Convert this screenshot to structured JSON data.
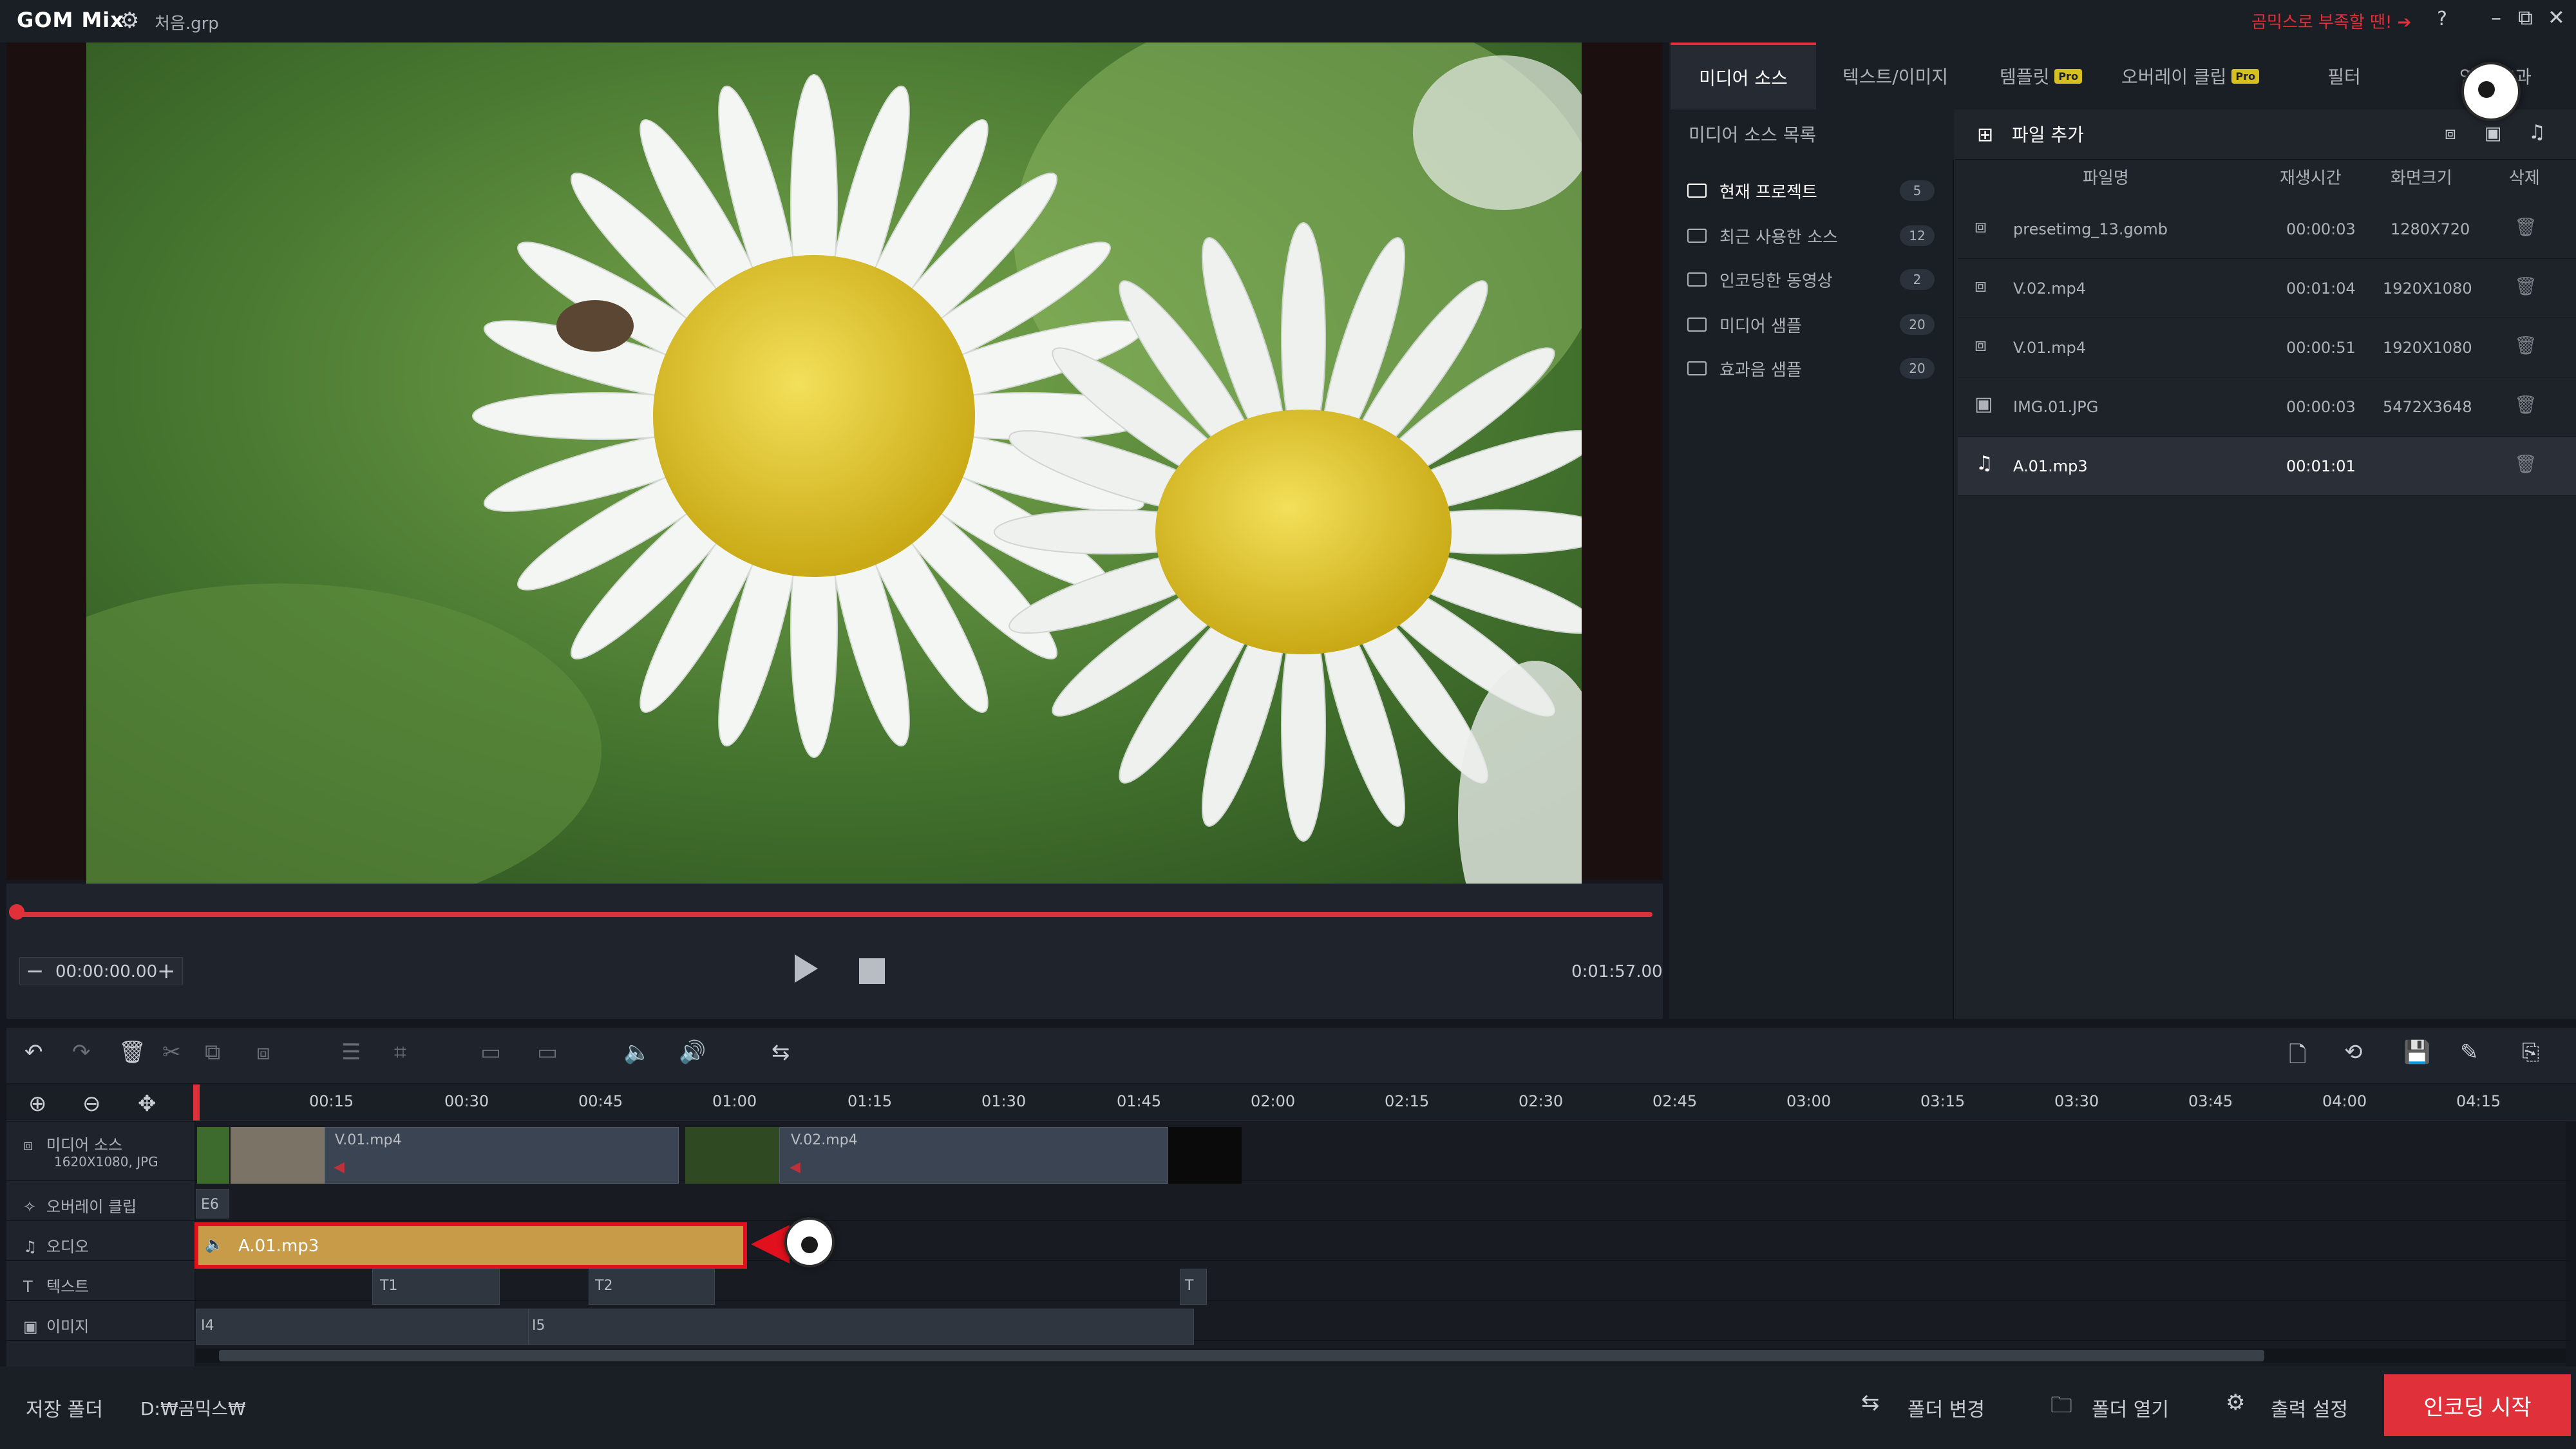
{
  "app": {
    "logo": "GOM Mix",
    "project_file": "처음.grp",
    "promo_text": "곰믹스로 부족할 땐! ➔",
    "help": "?",
    "win_min": "–",
    "win_max": "⧉",
    "win_close": "✕"
  },
  "player": {
    "current_time": "00:00:00.00",
    "total_time": "0:01:57.00",
    "minus": "−",
    "plus": "+"
  },
  "tabs": [
    {
      "label": "미디어 소스",
      "pro": false,
      "active": true
    },
    {
      "label": "텍스트/이미지",
      "pro": false,
      "active": false
    },
    {
      "label": "템플릿",
      "pro": true,
      "active": false
    },
    {
      "label": "오버레이 클립",
      "pro": true,
      "active": false
    },
    {
      "label": "필터",
      "pro": false,
      "active": false
    },
    {
      "label": "영상 효과",
      "pro": false,
      "active": false
    }
  ],
  "pro_badge": "Pro",
  "source_tree": {
    "title": "미디어 소스 목록",
    "items": [
      {
        "label": "현재 프로젝트",
        "count": "5"
      },
      {
        "label": "최근 사용한 소스",
        "count": "12"
      },
      {
        "label": "인코딩한 동영상",
        "count": "2"
      },
      {
        "label": "미디어 샘플",
        "count": "20"
      },
      {
        "label": "효과음 샘플",
        "count": "20"
      }
    ]
  },
  "file_list": {
    "add_file": "파일 추가",
    "columns": {
      "name": "파일명",
      "duration": "재생시간",
      "size": "화면크기",
      "delete": "삭제"
    },
    "rows": [
      {
        "name": "presetimg_13.gomb",
        "duration": "00:00:03",
        "size": "1280X720",
        "icon": "film-icon"
      },
      {
        "name": "V.02.mp4",
        "duration": "00:01:04",
        "size": "1920X1080",
        "icon": "film-icon"
      },
      {
        "name": "V.01.mp4",
        "duration": "00:00:51",
        "size": "1920X1080",
        "icon": "film-icon"
      },
      {
        "name": "IMG.01.JPG",
        "duration": "00:00:03",
        "size": "5472X3648",
        "icon": "image-icon"
      },
      {
        "name": "A.01.mp3",
        "duration": "00:01:01",
        "size": "",
        "icon": "music-icon"
      }
    ]
  },
  "timeline": {
    "ticks": [
      "00:15",
      "00:30",
      "00:45",
      "01:00",
      "01:15",
      "01:30",
      "01:45",
      "02:00",
      "02:15",
      "02:30",
      "02:45",
      "03:00",
      "03:15",
      "03:30",
      "03:45",
      "04:00",
      "04:15"
    ],
    "tracks": {
      "media": {
        "label": "미디어 소스",
        "sub": "1620X1080, JPG"
      },
      "overlay": {
        "label": "오버레이 클립"
      },
      "audio": {
        "label": "오디오"
      },
      "text": {
        "label": "텍스트"
      },
      "image": {
        "label": "이미지"
      }
    },
    "clips": {
      "v01": "V.01.mp4",
      "v02": "V.02.mp4",
      "overlay_e6": "E6",
      "audio": "A.01.mp3",
      "t1": "T1",
      "t2": "T2",
      "t": "T",
      "i4": "I4",
      "i5": "I5"
    }
  },
  "bottom": {
    "save_folder_label": "저장 폴더",
    "save_path": "D:₩곰믹스₩",
    "change_folder": "폴더 변경",
    "open_folder": "폴더 열기",
    "output_settings": "출력 설정",
    "start_encoding": "인코딩 시작"
  },
  "colors": {
    "accent": "#e0303a",
    "audio_clip": "#c79b48",
    "pro_badge": "#d6c021"
  }
}
